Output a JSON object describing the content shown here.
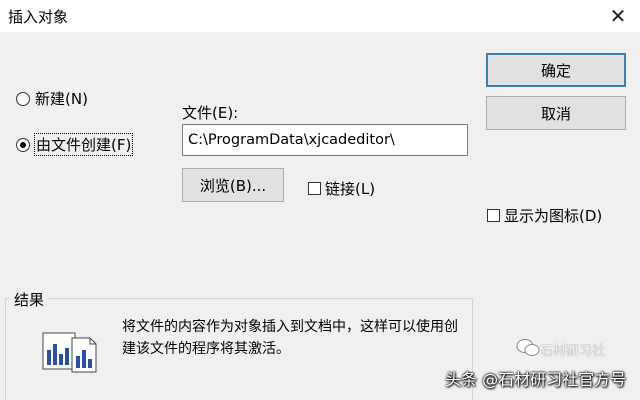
{
  "window": {
    "title": "插入对象",
    "close_glyph": "✕"
  },
  "options": {
    "new_label": "新建(N)",
    "from_file_label": "由文件创建(F)",
    "selected": "from_file"
  },
  "file": {
    "label": "文件(E):",
    "value": "C:\\ProgramData\\xjcadeditor\\"
  },
  "buttons": {
    "ok": "确定",
    "cancel": "取消",
    "browse": "浏览(B)..."
  },
  "checkboxes": {
    "link_label": "链接(L)",
    "link_checked": false,
    "display_as_icon_label": "显示为图标(D)",
    "display_as_icon_checked": false
  },
  "result": {
    "group_label": "结果",
    "description": "将文件的内容作为对象插入到文档中，这样可以使用创建该文件的程序将其激活。",
    "icon": "embedded-object-icon"
  },
  "watermark": {
    "text": "头条 @石材研习社官方号",
    "ghost_text": "石材研习社"
  },
  "colors": {
    "default_button_border": "#3c7fb1",
    "dialog_bg": "#f0f0f0"
  }
}
